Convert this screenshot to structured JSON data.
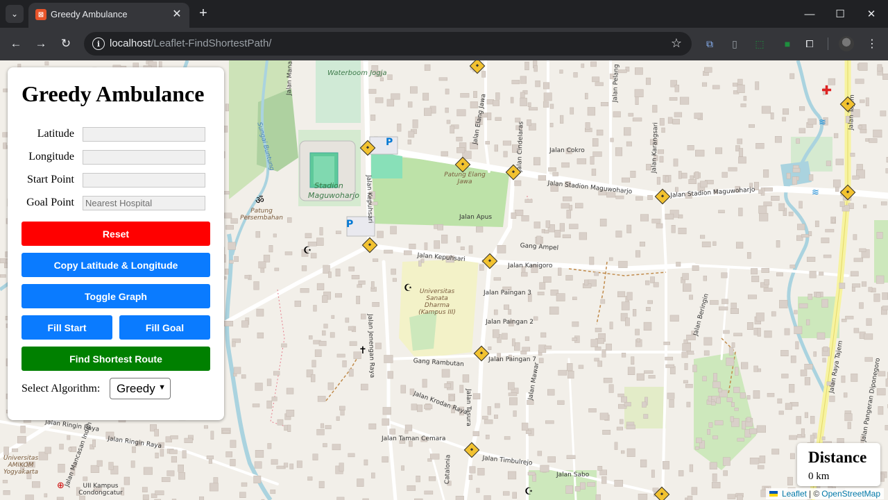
{
  "browser": {
    "tab_title": "Greedy Ambulance",
    "url_host": "localhost",
    "url_path": "/Leaflet-FindShortestPath/"
  },
  "panel": {
    "title": "Greedy Ambulance",
    "latitude_label": "Latitude",
    "latitude_value": "",
    "longitude_label": "Longitude",
    "longitude_value": "",
    "start_label": "Start Point",
    "start_value": "",
    "goal_label": "Goal Point",
    "goal_placeholder": "Nearest Hospital",
    "reset_label": "Reset",
    "copy_label": "Copy Latitude & Longitude",
    "toggle_label": "Toggle Graph",
    "fill_start_label": "Fill Start",
    "fill_goal_label": "Fill Goal",
    "find_label": "Find Shortest Route",
    "algorithm_label": "Select Algorithm:",
    "algorithm_value": "Greedy",
    "colors": {
      "reset": "#ff0000",
      "primary": "#0a7bff",
      "find": "#008000"
    }
  },
  "distance": {
    "title": "Distance",
    "value": "0 km"
  },
  "attribution": {
    "leaflet": "Leaflet",
    "separator": "| ©",
    "osm": "OpenStreetMap"
  },
  "map_labels": {
    "waterboom": "Waterboom Jogja",
    "stadion": "Stadion Maguwoharjo",
    "patung_elang": "Patung Elang Jawa",
    "patung_persembahan": "Patung Persembahan",
    "universitas_sanata": "Universitas Sanata Dharma (Kampus III)",
    "amikom": "Universitas AMIKOM Yogyakarta",
    "uii": "UII Kampus Condongcatur",
    "sungai_buntung": "Sungai Buntung",
    "jalan_stadion_1": "Jalan Stadion Maguwoharjo",
    "jalan_stadion_2": "Jalan Stadion Maguwoharjo",
    "jalan_kepuhsari": "Jalan Kepuhsari",
    "jalan_kepuhsari_v": "Jalan Kepuhsari",
    "jalan_kanigoro": "Jalan Kanigoro",
    "gang_ampel": "Gang Ampel",
    "jalan_apus": "Jalan Apus",
    "jalan_cokro": "Jalan Cokro",
    "jalan_paingan_3": "Jalan Paingan 3",
    "jalan_paingan_2": "Jalan Paingan 2",
    "jalan_paingan_7": "Jalan Paingan 7",
    "gang_rambutan": "Gang Rambutan",
    "jalan_krodan": "Jalan Krodan Raya",
    "jalan_taman_cemara": "Jalan Taman Cemara",
    "jalan_timbulrejo": "Jalan Timbulrejo",
    "jalan_sabo": "Jalan Sabo",
    "jalan_ringin_raya": "Jalan Ringin Raya",
    "jalan_ringin_raya_2": "Jalan Ringin Raya",
    "jalan_mancasan": "Jalan Mancasan Indah",
    "jalan_raya_tajem": "Jalan Raya Tajem",
    "jalan_tajem": "Jalan Tajem",
    "jalan_pangeran": "Jalan Pangeran Diponegoro",
    "jalan_jenengan": "Jalan Jenengan Raya",
    "jalan_tasura": "Jalan Tasura",
    "jalan_mawar": "Jalan Mawar",
    "jalan_cindelaras": "Jalan Cindelaras",
    "jalan_elang_jawa": "Jalan Elang Jawa",
    "jalan_karangsari": "Jalan Karangsari",
    "jalan_beringin": "Jalan Beringin",
    "jalan_pelang": "Jalan Pelang",
    "jalan_manan": "Jalan Manan",
    "catalonia": "Catalonia"
  }
}
